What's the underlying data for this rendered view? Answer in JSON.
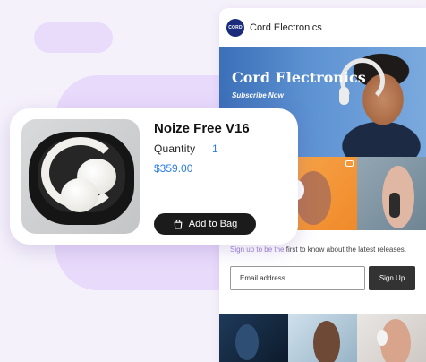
{
  "product": {
    "title": "Noize Free V16",
    "quantity_label": "Quantity",
    "quantity_value": "1",
    "price": "$359.00",
    "add_button": "Add to Bag",
    "bag_icon": "shopping-bag-icon"
  },
  "email": {
    "logo_text": "CORD",
    "brand_name": "Cord Electronics",
    "hero_title": "Cord Electronics",
    "hero_subtitle": "Subscribe Now",
    "signup_accent": "Sign up to be the",
    "signup_text": " first to know about the latest releases.",
    "email_placeholder": "Email address",
    "signup_button": "Sign Up"
  },
  "colors": {
    "accent_blue": "#2a7de1",
    "button_dark": "#1b1b1b",
    "background": "#f5f1fb",
    "blob": "#e8dafb",
    "brand_logo": "#1a2b7c"
  }
}
